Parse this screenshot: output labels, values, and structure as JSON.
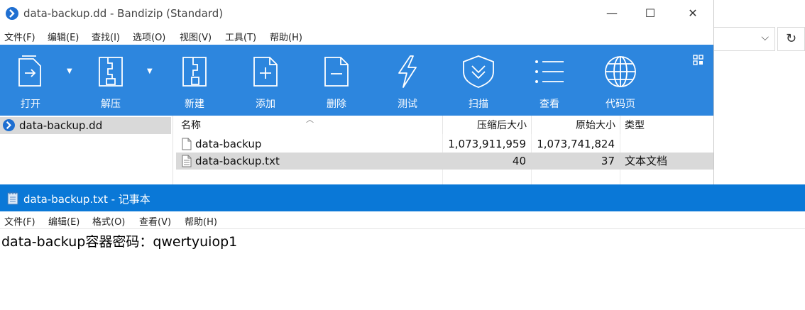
{
  "bandizip": {
    "title": "data-backup.dd - Bandizip (Standard)",
    "window_controls": {
      "minimize": "—",
      "maximize": "☐",
      "close": "✕"
    },
    "menu": [
      "文件(F)",
      "编辑(E)",
      "查找(I)",
      "选项(O)",
      "视图(V)",
      "工具(T)",
      "帮助(H)"
    ],
    "toolbar": {
      "open": "打开",
      "extract": "解压",
      "new": "新建",
      "add": "添加",
      "delete": "删除",
      "test": "测试",
      "scan": "扫描",
      "view": "查看",
      "codepage": "代码页"
    },
    "tree": {
      "item": "data-backup.dd"
    },
    "columns": {
      "name": "名称",
      "compressed": "压缩后大小",
      "original": "原始大小",
      "type": "类型"
    },
    "files": [
      {
        "name": "data-backup",
        "compressed": "1,073,911,959",
        "original": "1,073,741,824",
        "type": ""
      },
      {
        "name": "data-backup.txt",
        "compressed": "40",
        "original": "37",
        "type": "文本文档"
      }
    ]
  },
  "notepad": {
    "title": "data-backup.txt - 记事本",
    "menu": [
      "文件(F)",
      "编辑(E)",
      "格式(O)",
      "查看(V)",
      "帮助(H)"
    ],
    "content": "data-backup容器密码：qwertyuiop1"
  },
  "colors": {
    "toolbar": "#2d86de",
    "notepad_title": "#0a78d7",
    "selection": "#d9d9d9"
  },
  "icons": [
    "bandizip-logo-icon",
    "open-icon",
    "extract-icon",
    "new-icon",
    "add-icon",
    "delete-icon",
    "test-icon",
    "scan-icon",
    "view-icon",
    "codepage-icon",
    "file-icon",
    "text-file-icon",
    "notepad-icon",
    "chevron-down-icon",
    "refresh-icon"
  ]
}
